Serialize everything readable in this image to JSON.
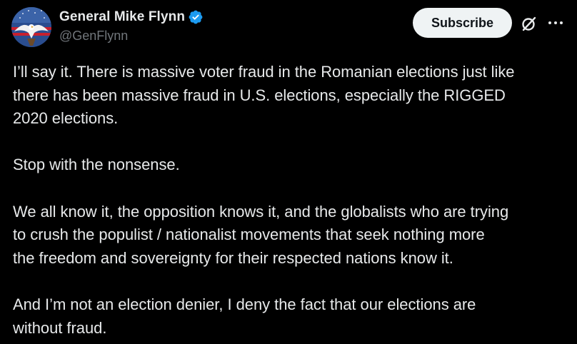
{
  "author": {
    "display_name": "General Mike Flynn",
    "handle": "@GenFlynn",
    "verified": true,
    "verified_color": "#1d9bf0"
  },
  "actions": {
    "subscribe_label": "Subscribe",
    "grok_icon": "grok-icon",
    "more_icon": "more-horizontal-icon"
  },
  "tweet": {
    "paragraphs": [
      "I’ll say it. There is massive voter fraud in the Romanian elections just like\nthere has been massive fraud in U.S. elections, especially the RIGGED\n2020 elections.",
      "Stop with the nonsense.",
      "We all know it, the opposition knows it, and the globalists who are trying\nto crush the populist / nationalist movements that seek nothing more\nthe freedom and sovereignty for their respected nations know it.",
      "And I’m not an election denier, I deny the fact that our elections are\nwithout fraud."
    ]
  },
  "colors": {
    "background": "#000000",
    "text_primary": "#e7e9ea",
    "text_secondary": "#71767b",
    "button_bg": "#eff3f4"
  }
}
